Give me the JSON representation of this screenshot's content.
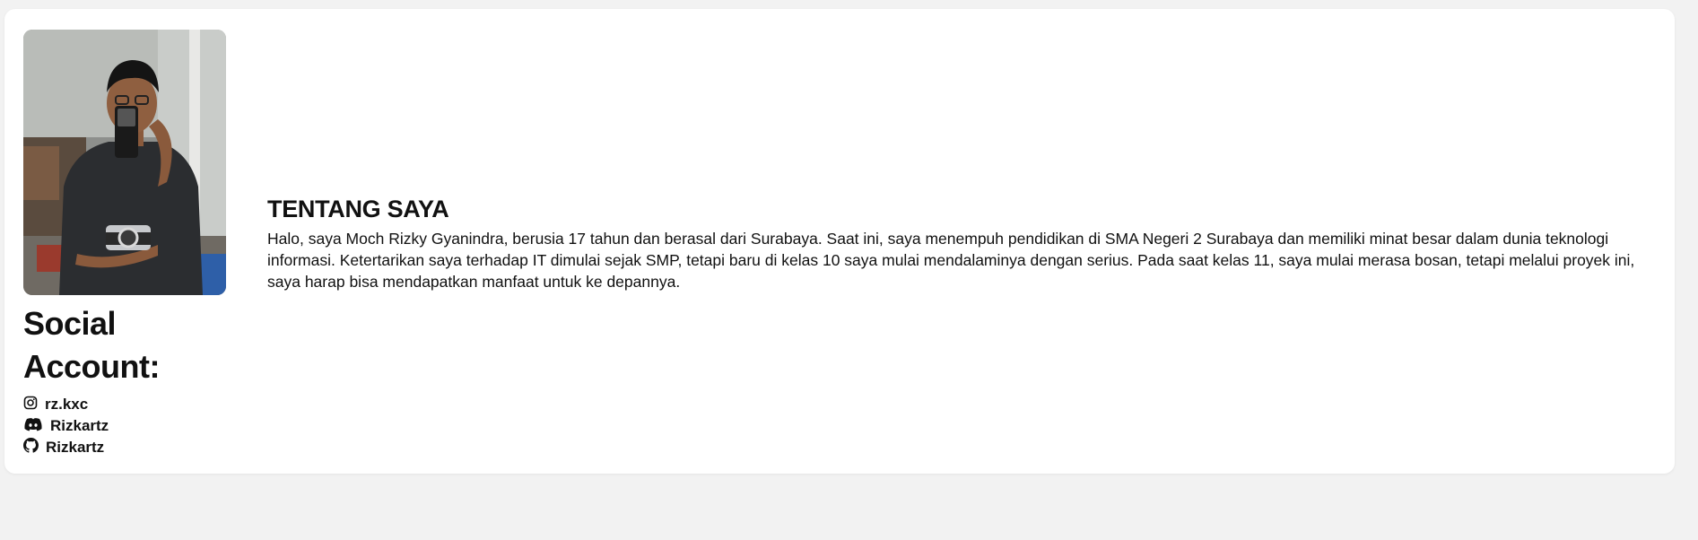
{
  "profile": {
    "photo_alt": "profile-photo"
  },
  "social": {
    "title": "Social Account:",
    "items": [
      {
        "icon": "instagram-icon",
        "label": "rz.kxc"
      },
      {
        "icon": "discord-icon",
        "label": "Rizkartz"
      },
      {
        "icon": "github-icon",
        "label": "Rizkartz"
      }
    ]
  },
  "about": {
    "title": "TENTANG SAYA",
    "text": "Halo, saya Moch Rizky Gyanindra, berusia 17 tahun dan berasal dari Surabaya. Saat ini, saya menempuh pendidikan di SMA Negeri 2 Surabaya dan memiliki minat besar dalam dunia teknologi informasi. Ketertarikan saya terhadap IT dimulai sejak SMP, tetapi baru di kelas 10 saya mulai mendalaminya dengan serius. Pada saat kelas 11, saya mulai merasa bosan, tetapi melalui proyek ini, saya harap bisa mendapatkan manfaat untuk ke depannya."
  },
  "colors": {
    "page_background": "#f2f2f2",
    "card_background": "#ffffff",
    "text": "#111111"
  }
}
